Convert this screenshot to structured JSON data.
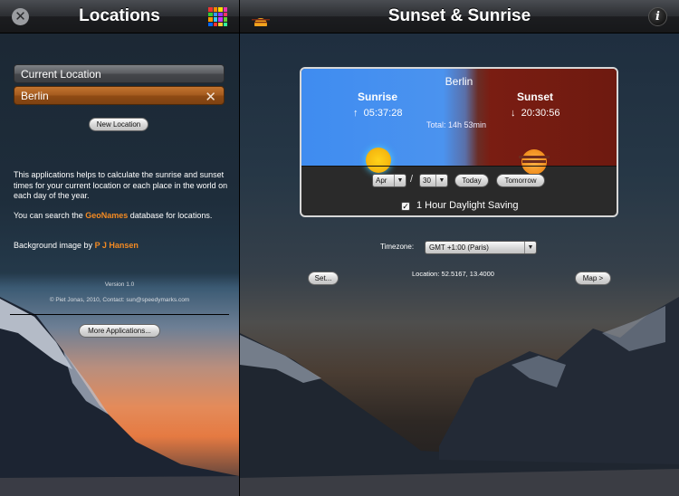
{
  "left_panel": {
    "title": "Locations",
    "locations": [
      "Current Location",
      "Berlin"
    ],
    "new_location_label": "New Location",
    "info": {
      "paragraph1": "This applications helps to calculate the sunrise and sunset times for your current location or each place in the world on each day of the year.",
      "search_prefix": "You can search the ",
      "search_link": "GeoNames",
      "search_suffix": " database for locations.",
      "background_prefix": "Background image by ",
      "background_credit": "P J Hansen"
    },
    "version": "Version 1.0",
    "copyright": "© Piet Jonas, 2010, Contact: sun@speedymarks.com",
    "more_apps_label": "More Applications..."
  },
  "right_panel": {
    "title": "Sunset & Sunrise",
    "info_glyph": "i",
    "card": {
      "city": "Berlin",
      "sunrise_label": "Sunrise",
      "sunrise_arrow": "↑",
      "sunrise_time": "05:37:28",
      "sunset_label": "Sunset",
      "sunset_arrow": "↓",
      "sunset_time": "20:30:56",
      "total": "Total: 14h 53min",
      "month": "Apr",
      "separator": "/",
      "day": "30",
      "today_label": "Today",
      "tomorrow_label": "Tomorrow",
      "dst_checked_glyph": "✓",
      "dst_label": "1 Hour Daylight Saving"
    },
    "timezone_label": "Timezone:",
    "timezone_value": "GMT +1:00 (Paris)",
    "set_label": "Set...",
    "location_text": "Location:  52.5167,  13.4000",
    "map_label": "Map >"
  },
  "icons": {
    "close": "close-icon",
    "color_grid": "color-grid-icon",
    "clear": "clear-icon",
    "sun_logo": "sun-logo-icon",
    "info": "info-icon",
    "dropdown": "dropdown-arrow-icon"
  },
  "colors": {
    "accent_orange": "#f48a22",
    "selected_location": "#a35a1e",
    "sky_day": "#4b93ef",
    "sky_night": "#7a1d12"
  }
}
